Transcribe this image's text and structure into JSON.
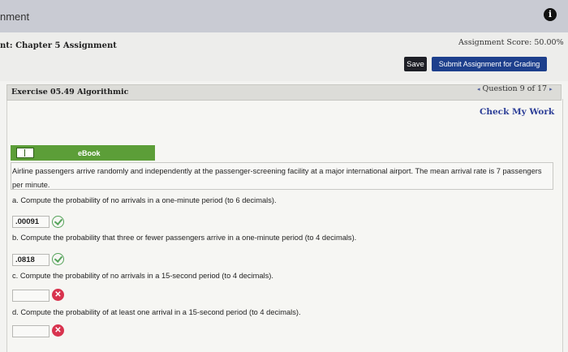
{
  "window": {
    "title": "nment",
    "info_icon": "i"
  },
  "header": {
    "assignment_title": "nt: Chapter 5 Assignment",
    "score": "Assignment Score: 50.00%",
    "save_label": "Save",
    "submit_label": "Submit Assignment for Grading"
  },
  "exercise": {
    "title": "Exercise 05.49 Algorithmic",
    "question_nav": {
      "prev": "◂",
      "label": "Question 9 of 17",
      "next": "▸"
    },
    "check_work": "Check My Work"
  },
  "ebook": {
    "label": "eBook"
  },
  "problem": {
    "text": "Airline passengers arrive randomly and independently at the passenger-screening facility at a major international airport. The mean arrival rate is 7 passengers per minute."
  },
  "questions": [
    {
      "prompt": "a. Compute the probability of no arrivals in a one-minute period (to 6 decimals).",
      "answer": ".00091",
      "status": "correct"
    },
    {
      "prompt": "b. Compute the probability that three or fewer passengers arrive in a one-minute period (to 4 decimals).",
      "answer": ".0818",
      "status": "correct"
    },
    {
      "prompt": "c. Compute the probability of no arrivals in a 15-second period (to 4 decimals).",
      "answer": "",
      "status": "incorrect"
    },
    {
      "prompt": "d. Compute the probability of at least one arrival in a 15-second period (to 4 decimals).",
      "answer": "",
      "status": "incorrect"
    }
  ],
  "icons": {
    "correct": "check-circle-icon",
    "incorrect": "x-circle-icon",
    "ebook": "book-icon"
  },
  "colors": {
    "submit": "#1d3f8c",
    "ebook": "#5c9e38",
    "correct": "#55a35a",
    "incorrect": "#d8334e",
    "link": "#2c3e97"
  }
}
